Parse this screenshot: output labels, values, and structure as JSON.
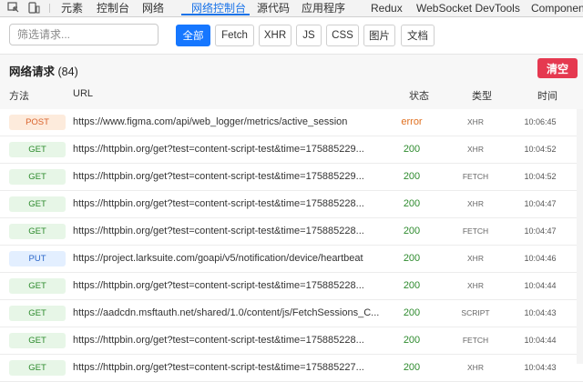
{
  "tabs": [
    {
      "label": "元素"
    },
    {
      "label": "控制台"
    },
    {
      "label": "网络"
    },
    {
      "label": "网络控制台",
      "active": true
    },
    {
      "label": "源代码"
    },
    {
      "label": "应用程序"
    },
    {
      "label": "Redux"
    },
    {
      "label": "WebSocket DevTools"
    },
    {
      "label": "Components"
    }
  ],
  "filter": {
    "search_placeholder": "筛选请求...",
    "buttons": [
      {
        "label": "全部",
        "active": true
      },
      {
        "label": "Fetch"
      },
      {
        "label": "XHR"
      },
      {
        "label": "JS"
      },
      {
        "label": "CSS"
      },
      {
        "label": "图片"
      },
      {
        "label": "文档"
      }
    ]
  },
  "requests": {
    "title": "网络请求",
    "count": "(84)",
    "clear_label": "清空",
    "columns": {
      "method": "方法",
      "url": "URL",
      "status": "状态",
      "type": "类型",
      "time": "时间"
    },
    "rows": [
      {
        "method": "POST",
        "url": "https://www.figma.com/api/web_logger/metrics/active_session",
        "status": "error",
        "type": "XHR",
        "time": "10:06:45"
      },
      {
        "method": "GET",
        "url": "https://httpbin.org/get?test=content-script-test&time=175885229...",
        "status": "200",
        "type": "XHR",
        "time": "10:04:52"
      },
      {
        "method": "GET",
        "url": "https://httpbin.org/get?test=content-script-test&time=175885229...",
        "status": "200",
        "type": "FETCH",
        "time": "10:04:52"
      },
      {
        "method": "GET",
        "url": "https://httpbin.org/get?test=content-script-test&time=175885228...",
        "status": "200",
        "type": "XHR",
        "time": "10:04:47"
      },
      {
        "method": "GET",
        "url": "https://httpbin.org/get?test=content-script-test&time=175885228...",
        "status": "200",
        "type": "FETCH",
        "time": "10:04:47"
      },
      {
        "method": "PUT",
        "url": "https://project.larksuite.com/goapi/v5/notification/device/heartbeat",
        "status": "200",
        "type": "XHR",
        "time": "10:04:46"
      },
      {
        "method": "GET",
        "url": "https://httpbin.org/get?test=content-script-test&time=175885228...",
        "status": "200",
        "type": "XHR",
        "time": "10:04:44"
      },
      {
        "method": "GET",
        "url": "https://aadcdn.msftauth.net/shared/1.0/content/js/FetchSessions_C...",
        "status": "200",
        "type": "SCRIPT",
        "time": "10:04:43"
      },
      {
        "method": "GET",
        "url": "https://httpbin.org/get?test=content-script-test&time=175885228...",
        "status": "200",
        "type": "FETCH",
        "time": "10:04:44"
      },
      {
        "method": "GET",
        "url": "https://httpbin.org/get?test=content-script-test&time=175885227...",
        "status": "200",
        "type": "XHR",
        "time": "10:04:43"
      }
    ]
  },
  "colors": {
    "accent": "#1a73e8",
    "active_filter": "#1677ff",
    "clear": "#e53950",
    "ok": "#2e8b2e",
    "error": "#e07020"
  }
}
